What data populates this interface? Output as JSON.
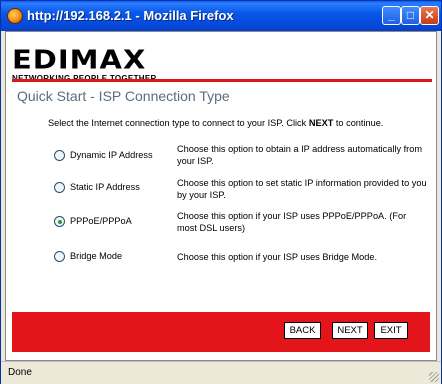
{
  "window": {
    "title": "http://192.168.2.1 - Mozilla Firefox",
    "min_glyph": "_",
    "max_glyph": "□",
    "close_glyph": "✕"
  },
  "logo": {
    "wordmark": "EDIMAX",
    "tagline": "NETWORKING PEOPLE TOGETHER"
  },
  "page": {
    "title": "Quick Start - ISP Connection Type",
    "instruction_pre": "Select the Internet connection type to connect to your ISP. Click ",
    "instruction_bold": "NEXT",
    "instruction_post": " to continue."
  },
  "options": [
    {
      "label": "Dynamic IP Address",
      "desc": "Choose this option to obtain a IP address automatically from your ISP.",
      "selected": false
    },
    {
      "label": "Static IP Address",
      "desc": "Choose this option to set static IP information provided to you by your ISP.",
      "selected": false
    },
    {
      "label": "PPPoE/PPPoA",
      "desc": "Choose this option if your ISP uses PPPoE/PPPoA. (For most DSL users)",
      "selected": true
    },
    {
      "label": "Bridge Mode",
      "desc": "Choose this option if your ISP uses Bridge Mode.",
      "selected": false
    }
  ],
  "buttons": {
    "back": "BACK",
    "next": "NEXT",
    "exit": "EXIT"
  },
  "status": {
    "text": "Done"
  },
  "colors": {
    "brand_red": "#e3151a",
    "title_blue": "#5a6c84",
    "titlebar_blue": "#0858e8"
  }
}
